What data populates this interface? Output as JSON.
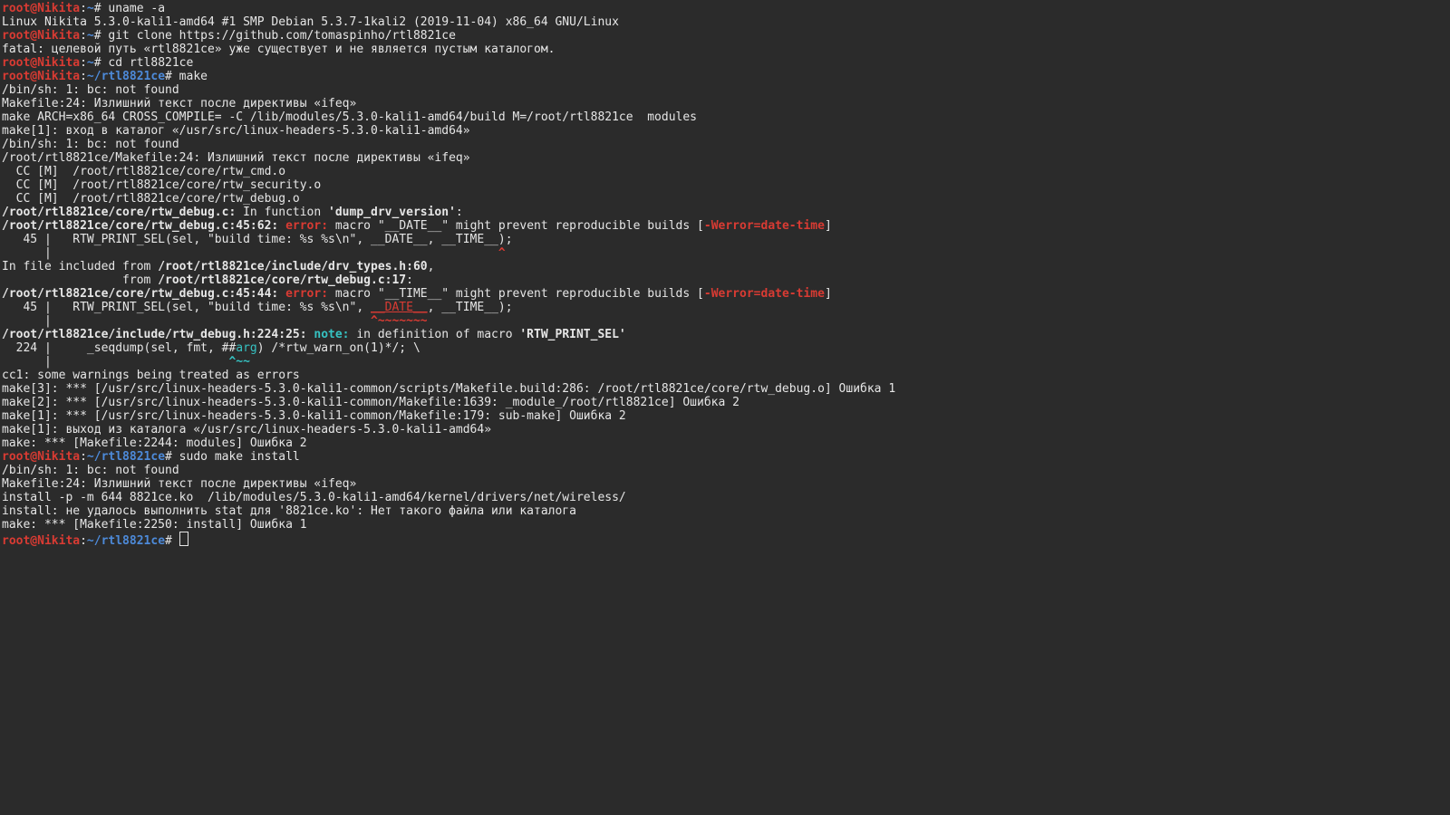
{
  "prompt": {
    "user_host": "root@Nikita",
    "sep1": ":",
    "home_sym": "~",
    "cwd": "/rtl8821ce",
    "hash": "#"
  },
  "cmd": {
    "uname": " uname -a",
    "uname_out": "Linux Nikita 5.3.0-kali1-amd64 #1 SMP Debian 5.3.7-1kali2 (2019-11-04) x86_64 GNU/Linux",
    "clone": " git clone https://github.com/tomaspinho/rtl8821ce",
    "clone_out": "fatal: целевой путь «rtl8821ce» уже существует и не является пустым каталогом.",
    "cd": " cd rtl8821ce",
    "make": " make",
    "install": " sudo make install"
  },
  "out": {
    "l1": "/bin/sh: 1: bc: not found",
    "l2": "Makefile:24: Излишний текст после директивы «ifeq»",
    "l3": "make ARCH=x86_64 CROSS_COMPILE= -C /lib/modules/5.3.0-kali1-amd64/build M=/root/rtl8821ce  modules",
    "l4": "make[1]: вход в каталог «/usr/src/linux-headers-5.3.0-kali1-amd64»",
    "l5": "/bin/sh: 1: bc: not found",
    "l6": "/root/rtl8821ce/Makefile:24: Излишний текст после директивы «ifeq»",
    "cc1": "  CC [M]  /root/rtl8821ce/core/rtw_cmd.o",
    "cc2": "  CC [M]  /root/rtl8821ce/core/rtw_security.o",
    "cc3": "  CC [M]  /root/rtl8821ce/core/rtw_debug.o",
    "fn_a": "/root/rtl8821ce/core/rtw_debug.c:",
    "fn_b": " In function ",
    "fn_c": "'dump_drv_version'",
    "fn_d": ":",
    "e1_a": "/root/rtl8821ce/core/rtw_debug.c:45:62: ",
    "e1_b": "error: ",
    "e1_c": "macro \"__DATE__\" might prevent reproducible builds [",
    "e1_d": "-Werror=date-time",
    "e1_e": "]",
    "code45": "   45 |   RTW_PRINT_SEL(sel, \"build time: %s %s\\n\", __DATE__, __TIME__);",
    "bar1": "      |                                                               ",
    "caret1": "^",
    "inc_a": "In file included from ",
    "inc_b": "/root/rtl8821ce/include/drv_types.h:60",
    "inc_c": ",",
    "inc_d": "                 from ",
    "inc_e": "/root/rtl8821ce/core/rtw_debug.c:17",
    "inc_f": ":",
    "e2_a": "/root/rtl8821ce/core/rtw_debug.c:45:44: ",
    "e2_b": "error: ",
    "e2_c": "macro \"__TIME__\" might prevent reproducible builds [",
    "e2_d": "-Werror=date-time",
    "e2_e": "]",
    "code45b_pre": "   45 |   RTW_PRINT_SEL(sel, \"build time: %s %s\\n\", ",
    "code45b_mid": "__DATE__",
    "code45b_post": ", __TIME__);",
    "bar2a": "      |                                             ",
    "tilde": "^~~~~~~~",
    "n_a": "/root/rtl8821ce/include/rtw_debug.h:224:25: ",
    "n_b": "note: ",
    "n_c": "in definition of macro ",
    "n_d": "'RTW_PRINT_SEL'",
    "code224_pre": "  224 |     _seqdump(sel, fmt, ##",
    "code224_arg": "arg",
    "code224_post": ") /*rtw_warn_on(1)*/; \\",
    "bar3a": "      |                         ",
    "tilde3": "^~~",
    "cc1w": "cc1: some warnings being treated as errors",
    "mk3": "make[3]: *** [/usr/src/linux-headers-5.3.0-kali1-common/scripts/Makefile.build:286: /root/rtl8821ce/core/rtw_debug.o] Ошибка 1",
    "mk2": "make[2]: *** [/usr/src/linux-headers-5.3.0-kali1-common/Makefile:1639: _module_/root/rtl8821ce] Ошибка 2",
    "mk1": "make[1]: *** [/usr/src/linux-headers-5.3.0-kali1-common/Makefile:179: sub-make] Ошибка 2",
    "mk1o": "make[1]: выход из каталога «/usr/src/linux-headers-5.3.0-kali1-amd64»",
    "mk0": "make: *** [Makefile:2244: modules] Ошибка 2",
    "i1": "/bin/sh: 1: bc: not found",
    "i2": "Makefile:24: Излишний текст после директивы «ifeq»",
    "i3": "install -p -m 644 8821ce.ko  /lib/modules/5.3.0-kali1-amd64/kernel/drivers/net/wireless/",
    "i4": "install: не удалось выполнить stat для '8821ce.ko': Нет такого файла или каталога",
    "i5": "make: *** [Makefile:2250: install] Ошибка 1"
  }
}
